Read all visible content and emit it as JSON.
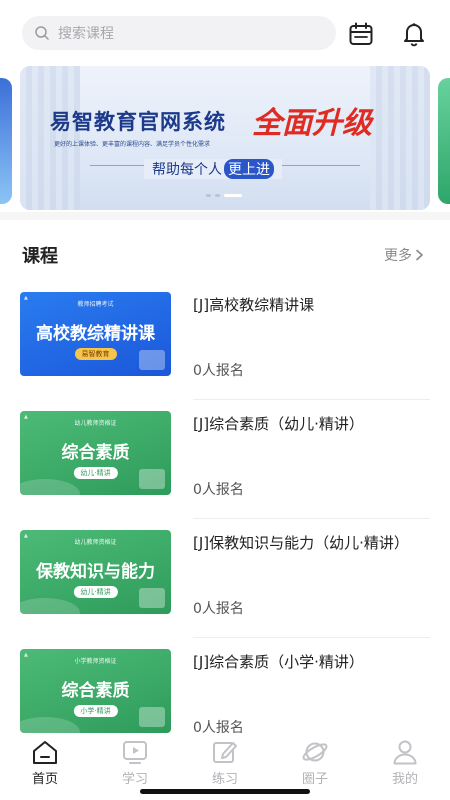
{
  "search": {
    "placeholder": "搜索课程",
    "icon": "search-icon"
  },
  "header_icons": [
    "calendar-icon",
    "bell-icon"
  ],
  "banner": {
    "title": "易智教育官网系统",
    "slogan": "全面升级",
    "subtitle": "更好的上课体验、更丰富的课程内容、满足学员个性化需求",
    "help_prefix": "帮助每个人",
    "help_highlight": "更上进"
  },
  "section": {
    "title": "课程",
    "more_label": "更多"
  },
  "courses": [
    {
      "title": "[J]高校教综精讲课",
      "enroll": "0人报名",
      "thumb": {
        "top": "教师招聘考试",
        "main": "高校教综精讲课",
        "tag": "易智教育",
        "theme": "blue"
      }
    },
    {
      "title": "[J]综合素质（幼儿·精讲）",
      "enroll": "0人报名",
      "thumb": {
        "top": "幼儿教师资格证",
        "main": "综合素质",
        "tag": "幼儿·精讲",
        "theme": "green"
      }
    },
    {
      "title": "[J]保教知识与能力（幼儿·精讲）",
      "enroll": "0人报名",
      "thumb": {
        "top": "幼儿教师资格证",
        "main": "保教知识与能力",
        "tag": "幼儿·精讲",
        "theme": "green"
      }
    },
    {
      "title": "[J]综合素质（小学·精讲）",
      "enroll": "0人报名",
      "thumb": {
        "top": "小学教师资格证",
        "main": "综合素质",
        "tag": "小学·精讲",
        "theme": "green"
      }
    }
  ],
  "tabs": [
    {
      "label": "首页",
      "icon": "home-icon",
      "active": true
    },
    {
      "label": "学习",
      "icon": "play-video-icon",
      "active": false
    },
    {
      "label": "练习",
      "icon": "edit-icon",
      "active": false
    },
    {
      "label": "圈子",
      "icon": "planet-icon",
      "active": false
    },
    {
      "label": "我的",
      "icon": "user-icon",
      "active": false
    }
  ],
  "colors": {
    "accent": "#1b57d9",
    "green": "#2e9b5b",
    "slogan_red": "#e02b22",
    "tab_inactive": "#b2b2b7"
  }
}
